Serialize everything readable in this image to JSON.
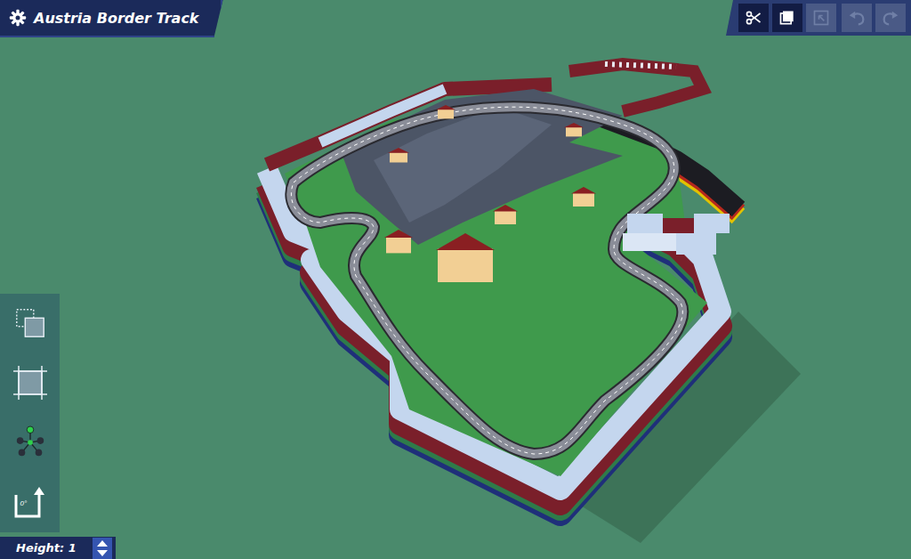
{
  "window": {
    "title": "Austria Border Track"
  },
  "toolbar": {
    "buttons": [
      {
        "kind": "cut",
        "disabled": false
      },
      {
        "kind": "copy",
        "disabled": false
      },
      {
        "kind": "paste",
        "disabled": true
      }
    ],
    "history": [
      {
        "kind": "undo",
        "disabled": true
      },
      {
        "kind": "redo",
        "disabled": true
      }
    ]
  },
  "tools": [
    {
      "kind": "select",
      "selected": false
    },
    {
      "kind": "area",
      "selected": false
    },
    {
      "kind": "move",
      "selected": false
    },
    {
      "kind": "rotate",
      "selected": false,
      "label": "0°"
    }
  ],
  "height": {
    "label": "Height: 1"
  }
}
